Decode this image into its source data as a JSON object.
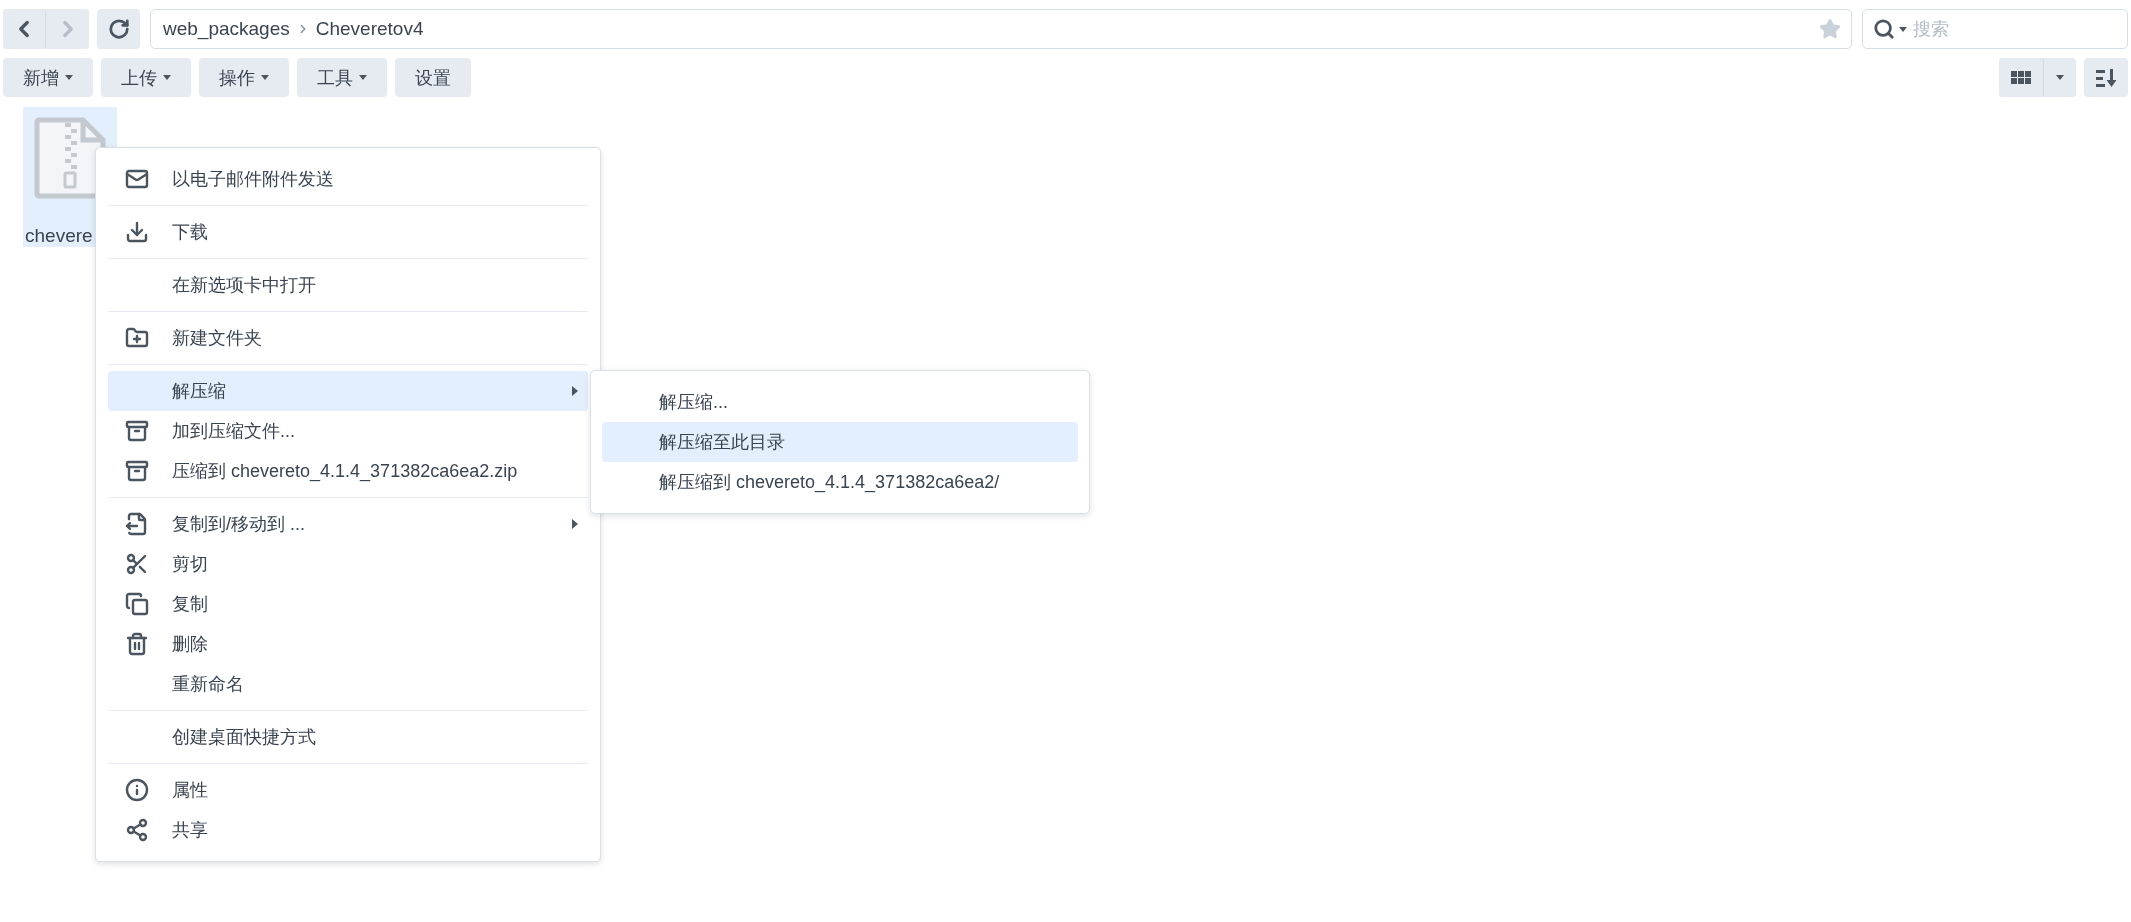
{
  "nav": {
    "back": {
      "disabled": false
    },
    "forward": {
      "disabled": true
    }
  },
  "address_bar": {
    "path": [
      "web_packages",
      "Cheveretov4"
    ],
    "favorite": false
  },
  "search": {
    "placeholder": "搜索"
  },
  "toolbar": [
    {
      "label": "新增",
      "dropdown": true
    },
    {
      "label": "上传",
      "dropdown": true
    },
    {
      "label": "操作",
      "dropdown": true
    },
    {
      "label": "工具",
      "dropdown": true
    },
    {
      "label": "设置",
      "dropdown": false
    }
  ],
  "files": [
    {
      "name": "chevere",
      "selected": true
    }
  ],
  "context_menu": {
    "groups": [
      [
        {
          "label": "以电子邮件附件发送",
          "has_submenu": false,
          "selected": false
        }
      ],
      [
        {
          "label": "下载",
          "has_submenu": false,
          "selected": false
        }
      ],
      [
        {
          "label": "在新选项卡中打开",
          "has_submenu": false,
          "selected": false
        }
      ],
      [
        {
          "label": "新建文件夹",
          "has_submenu": false,
          "selected": false
        }
      ],
      [
        {
          "label": "解压缩",
          "has_submenu": true,
          "selected": true
        },
        {
          "label": "加到压缩文件...",
          "has_submenu": false,
          "selected": false
        },
        {
          "label": "压缩到 chevereto_4.1.4_371382ca6ea2.zip",
          "has_submenu": false,
          "selected": false
        }
      ],
      [
        {
          "label": "复制到/移动到 ...",
          "has_submenu": true,
          "selected": false
        },
        {
          "label": "剪切",
          "has_submenu": false,
          "selected": false
        },
        {
          "label": "复制",
          "has_submenu": false,
          "selected": false
        },
        {
          "label": "删除",
          "has_submenu": false,
          "selected": false
        },
        {
          "label": "重新命名",
          "has_submenu": false,
          "selected": false
        }
      ],
      [
        {
          "label": "创建桌面快捷方式",
          "has_submenu": false,
          "selected": false
        }
      ],
      [
        {
          "label": "属性",
          "has_submenu": false,
          "selected": false
        },
        {
          "label": "共享",
          "has_submenu": false,
          "selected": false
        }
      ]
    ]
  },
  "submenu": {
    "items": [
      {
        "label": "解压缩...",
        "selected": false
      },
      {
        "label": "解压缩至此目录",
        "selected": true
      },
      {
        "label": "解压缩到 chevereto_4.1.4_371382ca6ea2/",
        "selected": false
      }
    ]
  }
}
